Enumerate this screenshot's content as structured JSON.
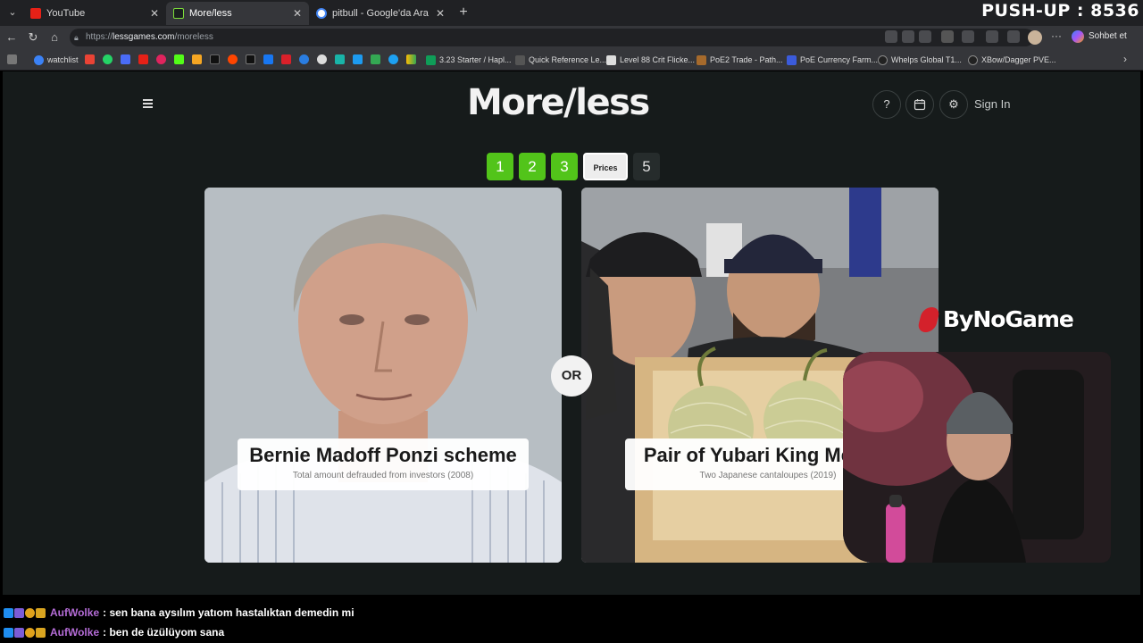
{
  "tabs": [
    {
      "title": "YouTube",
      "icon": "youtube-icon",
      "active": false
    },
    {
      "title": "More/less",
      "icon": "lessgames-icon",
      "active": true
    },
    {
      "title": "pitbull - Google'da Ara",
      "icon": "google-icon",
      "active": false
    }
  ],
  "overlay": {
    "pushup": "PUSH-UP : 8536",
    "sponsor": "ByNoGame"
  },
  "address": {
    "scheme": "https://",
    "host": "lessgames.com",
    "path": "/moreless",
    "sohbet": "Sohbet et"
  },
  "bookmarks": [
    {
      "label": "watchlist",
      "icon": "watchlist-icon"
    },
    {
      "label": "3.23 Starter / Hapl...",
      "icon": "sheets-icon"
    },
    {
      "label": "Quick Reference Le...",
      "icon": "bookmark-icon"
    },
    {
      "label": "Level 88 Crit Flicke...",
      "icon": "doc-icon"
    },
    {
      "label": "PoE2 Trade - Path...",
      "icon": "poe-icon"
    },
    {
      "label": "PoE Currency Farm...",
      "icon": "bookmark-icon"
    },
    {
      "label": "Whelps Global T1...",
      "icon": "bookmark-icon"
    },
    {
      "label": "XBow/Dagger PVE...",
      "icon": "bookmark-icon"
    }
  ],
  "site": {
    "logo": "More/less",
    "signin": "Sign In",
    "levels": [
      "1",
      "2",
      "3"
    ],
    "current_level": "Prices",
    "next_level": "5",
    "or_label": "OR"
  },
  "left_card": {
    "name": "Bernie Madoff Ponzi scheme",
    "sub": "Total amount defrauded from investors (2008)"
  },
  "right_card": {
    "name": "Pair of Yubari King Melons",
    "sub": "Two Japanese cantaloupes (2019)"
  },
  "chat": [
    {
      "user": "AufWolke",
      "msg": ": sen bana aysılım yatıom hastalıktan demedin mi"
    },
    {
      "user": "AufWolke",
      "msg": ": ben de üzülüyom sana"
    }
  ],
  "colors": {
    "green": "#52c41a",
    "page_bg": "#161b1b",
    "chat_user": "#b46cd6",
    "sponsor_red": "#d4212b"
  }
}
